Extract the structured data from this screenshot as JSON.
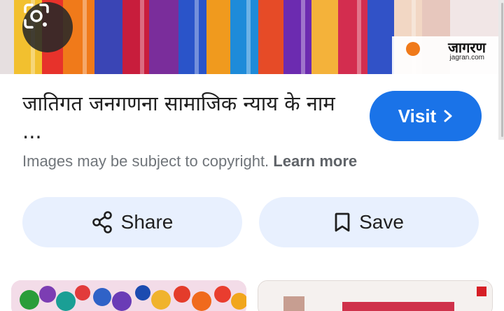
{
  "hero": {
    "lens_icon": "google-lens-icon",
    "brand_name": "जागरण",
    "brand_domain": "jagran.com"
  },
  "result": {
    "title": "जातिगत जनगणना सामाजिक न्याय के नाम ...",
    "visit_label": "Visit",
    "visit_icon": "chevron-right-icon",
    "copyright_text": "Images may be subject to copyright.",
    "learn_more_label": "Learn more"
  },
  "actions": {
    "share_label": "Share",
    "share_icon": "share-icon",
    "save_label": "Save",
    "save_icon": "bookmark-icon"
  },
  "colors": {
    "accent": "#1a73e8",
    "pill_bg": "#e8f0fe"
  }
}
